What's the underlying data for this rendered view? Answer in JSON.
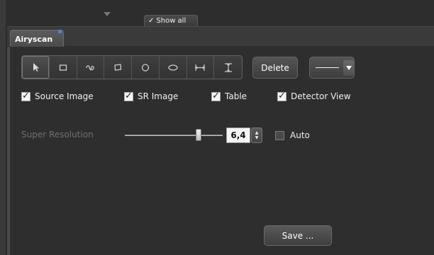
{
  "top": {
    "show_all_label": "Show all"
  },
  "tab": {
    "label": "Airyscan"
  },
  "toolbar": {
    "tools": [
      {
        "icon": "pointer-icon",
        "active": true
      },
      {
        "icon": "rectangle-icon"
      },
      {
        "icon": "freehand-icon"
      },
      {
        "icon": "rotated-rectangle-icon"
      },
      {
        "icon": "circle-icon"
      },
      {
        "icon": "ellipse-icon"
      },
      {
        "icon": "line-measure-icon"
      },
      {
        "icon": "vertical-measure-icon"
      }
    ],
    "delete_label": "Delete"
  },
  "checkboxes": [
    {
      "label": "Source Image",
      "checked": true
    },
    {
      "label": "SR Image",
      "checked": true
    },
    {
      "label": "Table",
      "checked": true
    },
    {
      "label": "Detector View",
      "checked": true
    }
  ],
  "super_resolution": {
    "label": "Super Resolution",
    "value": "6,4",
    "auto_label": "Auto",
    "auto_checked": false
  },
  "save_label": "Save ..."
}
